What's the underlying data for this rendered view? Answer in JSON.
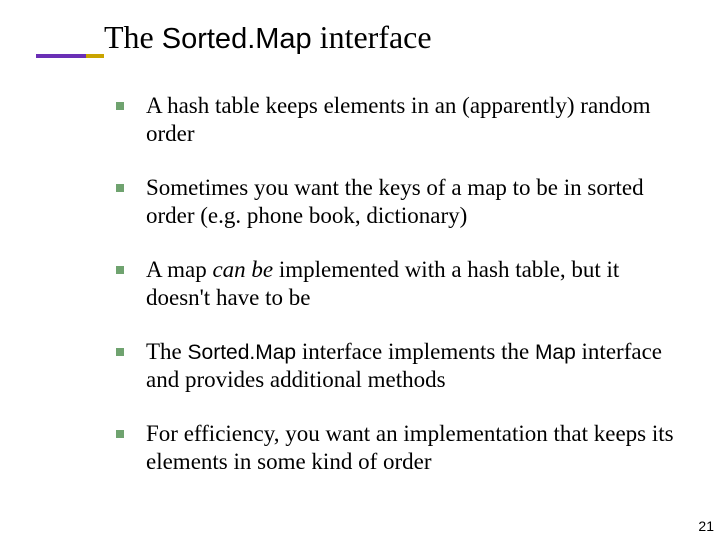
{
  "colors": {
    "bullet": "#6fa36f",
    "accent_purple": "#6a2fb5",
    "accent_gold": "#c9a400"
  },
  "title": {
    "pre": "The ",
    "code": "Sorted.Map",
    "post": " interface"
  },
  "bullets": [
    {
      "segments": [
        {
          "text": "A hash table keeps elements in an (apparently) random order"
        }
      ]
    },
    {
      "segments": [
        {
          "text": "Sometimes you want the keys of a map to be in sorted order (e.g. phone book, dictionary)"
        }
      ]
    },
    {
      "segments": [
        {
          "text": "A map "
        },
        {
          "text": "can be",
          "style": "italic"
        },
        {
          "text": " implemented with a hash table, but it doesn't have to be"
        }
      ]
    },
    {
      "segments": [
        {
          "text": "The "
        },
        {
          "text": "Sorted.Map",
          "style": "code"
        },
        {
          "text": " interface implements the "
        },
        {
          "text": "Map",
          "style": "code"
        },
        {
          "text": " interface and provides additional methods"
        }
      ]
    },
    {
      "segments": [
        {
          "text": "For efficiency, you want an implementation that keeps its elements in some kind of order"
        }
      ]
    }
  ],
  "page_number": "21"
}
